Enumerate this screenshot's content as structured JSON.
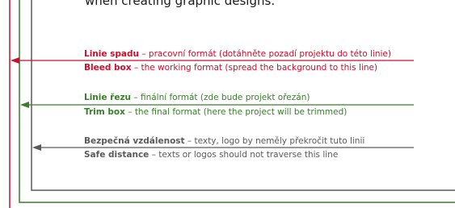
{
  "heading": "when creating graphic designs:",
  "colors": {
    "bleed": "#c8102e",
    "trim": "#3a7d2c",
    "safe": "#5a5a5a"
  },
  "bleed": {
    "cz_term": "Linie spadu",
    "cz_desc": " – pracovní formát (dotáhněte pozadí projektu do této linie)",
    "en_term": "Bleed box",
    "en_desc": " – the working format (spread the background to this line)"
  },
  "trim": {
    "cz_term": "Linie řezu",
    "cz_desc": " – finální formát (zde bude projekt ořezán)",
    "en_term": "Trim box",
    "en_desc": " – the final format (here the project will be trimmed)"
  },
  "safe": {
    "cz_term": "Bezpečná vzdálenost",
    "cz_desc": " – texty, logo by neměly překročit tuto linii",
    "en_term": "Safe distance",
    "en_desc": " – texts or logos should not traverse this line"
  }
}
